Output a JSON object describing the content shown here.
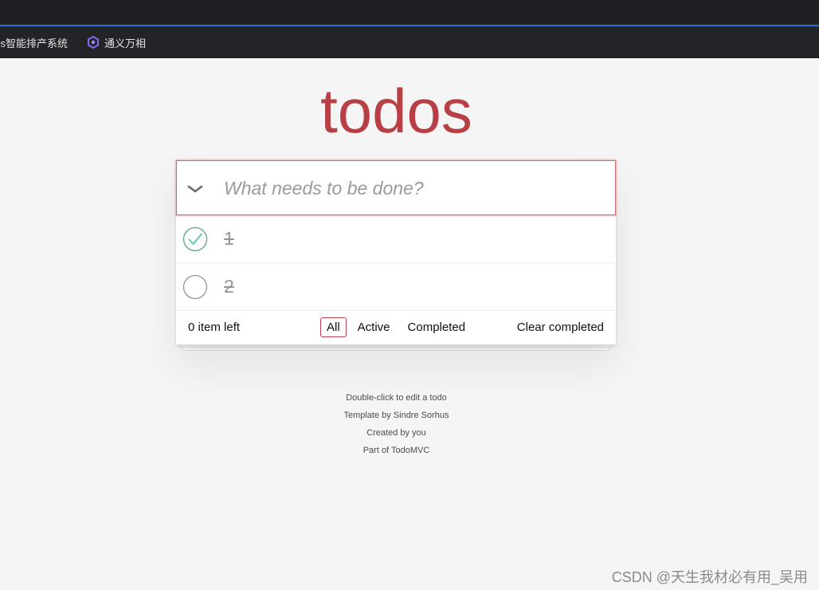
{
  "browser": {
    "bookmarks": [
      {
        "label": "aps智能排产系统"
      },
      {
        "label": "通义万相",
        "icon": "tongyi-logo-icon"
      }
    ],
    "colors": {
      "topbar": "#1f2024",
      "accent_line": "#2f6fd6"
    }
  },
  "app": {
    "title": "todos",
    "new_todo": {
      "placeholder": "What needs to be done?",
      "value": ""
    },
    "todos": [
      {
        "label": "1",
        "completed": true
      },
      {
        "label": "2",
        "completed": false
      }
    ],
    "footer": {
      "count_text": "0 item left",
      "filters": [
        {
          "label": "All",
          "selected": true
        },
        {
          "label": "Active",
          "selected": false
        },
        {
          "label": "Completed",
          "selected": false
        }
      ],
      "clear_label": "Clear completed"
    },
    "colors": {
      "title": "#b83f45",
      "check": "#3ea390",
      "selected_border": "#b83f45"
    }
  },
  "info": {
    "lines": [
      "Double-click to edit a todo",
      "Template by Sindre Sorhus",
      "Created by you",
      "Part of TodoMVC"
    ]
  },
  "watermark": "CSDN @天生我材必有用_吴用"
}
